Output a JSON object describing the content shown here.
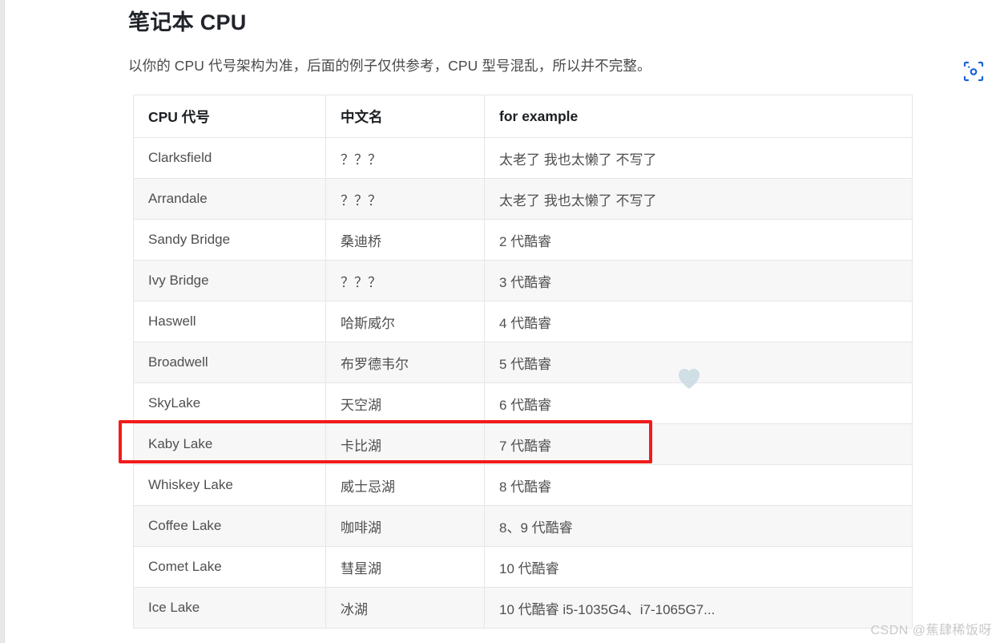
{
  "page": {
    "title": "笔记本 CPU",
    "subtitle": "以你的 CPU 代号架构为准，后面的例子仅供参考，CPU 型号混乱，所以并不完整。"
  },
  "toolbar": {
    "scan_icon": "scan-recognize-icon",
    "scan_icon_color": "#1a63d8"
  },
  "table": {
    "headers": [
      "CPU 代号",
      "中文名",
      "for example"
    ],
    "rows": [
      {
        "code": "Clarksfield",
        "cn": "？？？",
        "example": "太老了 我也太懒了 不写了"
      },
      {
        "code": "Arrandale",
        "cn": "？？？",
        "example": "太老了 我也太懒了 不写了"
      },
      {
        "code": "Sandy Bridge",
        "cn": "桑迪桥",
        "example": "2 代酷睿"
      },
      {
        "code": "Ivy Bridge",
        "cn": "？？？",
        "example": "3 代酷睿"
      },
      {
        "code": "Haswell",
        "cn": "哈斯威尔",
        "example": "4 代酷睿"
      },
      {
        "code": "Broadwell",
        "cn": "布罗德韦尔",
        "example": "5 代酷睿"
      },
      {
        "code": "SkyLake",
        "cn": "天空湖",
        "example": "6 代酷睿"
      },
      {
        "code": "Kaby Lake",
        "cn": "卡比湖",
        "example": "7 代酷睿"
      },
      {
        "code": "Whiskey Lake",
        "cn": "威士忌湖",
        "example": "8 代酷睿"
      },
      {
        "code": "Coffee Lake",
        "cn": "咖啡湖",
        "example": "8、9 代酷睿"
      },
      {
        "code": "Comet Lake",
        "cn": "彗星湖",
        "example": "10 代酷睿"
      },
      {
        "code": "Ice Lake",
        "cn": "冰湖",
        "example": "10 代酷睿 i5-1035G4、i7-1065G7..."
      }
    ]
  },
  "annotation": {
    "highlight_row_index": 7,
    "highlight_color": "#f21b1b"
  },
  "watermark": {
    "text": "CSDN @蕉肆稀饭呀"
  }
}
